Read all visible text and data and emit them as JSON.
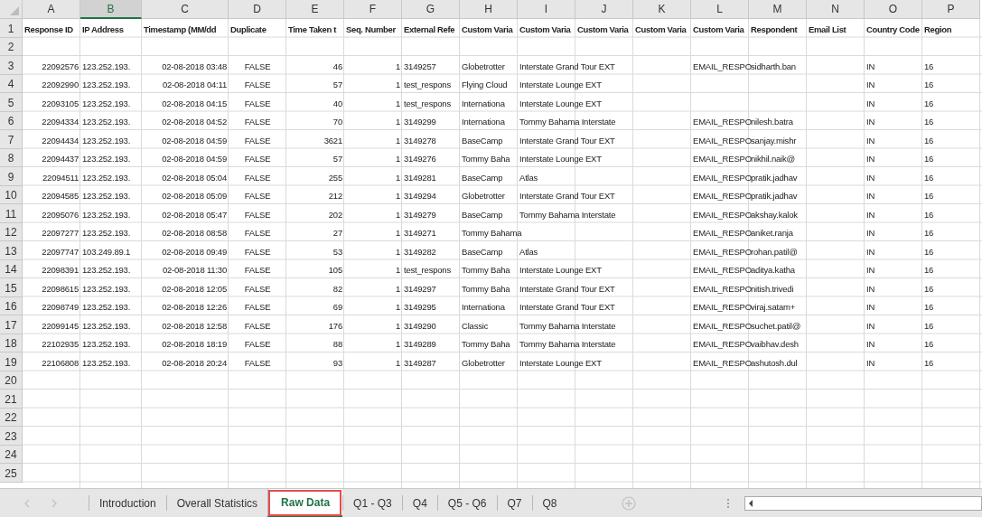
{
  "columns": [
    {
      "letter": "A",
      "kind": "number",
      "selected": false
    },
    {
      "letter": "B",
      "kind": "text",
      "selected": true
    },
    {
      "letter": "C",
      "kind": "date",
      "selected": false
    },
    {
      "letter": "D",
      "kind": "boolean",
      "selected": false
    },
    {
      "letter": "E",
      "kind": "number",
      "selected": false
    },
    {
      "letter": "F",
      "kind": "number",
      "selected": false
    },
    {
      "letter": "G",
      "kind": "text",
      "selected": false
    },
    {
      "letter": "H",
      "kind": "text",
      "selected": false
    },
    {
      "letter": "I",
      "kind": "text",
      "selected": false
    },
    {
      "letter": "J",
      "kind": "text",
      "selected": false
    },
    {
      "letter": "K",
      "kind": "text",
      "selected": false
    },
    {
      "letter": "L",
      "kind": "text",
      "selected": false
    },
    {
      "letter": "M",
      "kind": "text",
      "selected": false
    },
    {
      "letter": "N",
      "kind": "text",
      "selected": false
    },
    {
      "letter": "O",
      "kind": "text",
      "selected": false
    },
    {
      "letter": "P",
      "kind": "text",
      "selected": false
    }
  ],
  "rows": [
    {
      "num": "1",
      "kind": "header",
      "cells": {
        "A": "Response ID",
        "B": "IP Address",
        "C": "Timestamp (MM/dd",
        "D": "Duplicate",
        "E": "Time Taken t",
        "F": "Seq. Number",
        "G": "External Refe",
        "H": "Custom Varia",
        "I": "Custom Varia",
        "J": "Custom Varia",
        "K": "Custom Varia",
        "L": "Custom Varia",
        "M": "Respondent",
        "N": "Email List",
        "O": "Country Code",
        "P": "Region"
      }
    },
    {
      "num": "2",
      "kind": "data"
    },
    {
      "num": "3",
      "kind": "data",
      "cells": {
        "A": "22092576",
        "B": "123.252.193.",
        "C": "02-08-2018 03:48",
        "D": "FALSE",
        "E": "46",
        "F": "1",
        "G": "3149257",
        "H": "Globetrotter",
        "I": "Interstate Grand Tour EXT",
        "L": "EMAIL_RESPO",
        "M": "sidharth.ban",
        "O": "IN",
        "P": "16"
      }
    },
    {
      "num": "4",
      "kind": "data",
      "cells": {
        "A": "22092990",
        "B": "123.252.193.",
        "C": "02-08-2018 04:11",
        "D": "FALSE",
        "E": "57",
        "F": "1",
        "G": "test_respons",
        "H": "Flying Cloud",
        "I": "Interstate Lounge EXT",
        "O": "IN",
        "P": "16"
      }
    },
    {
      "num": "5",
      "kind": "data",
      "cells": {
        "A": "22093105",
        "B": "123.252.193.",
        "C": "02-08-2018 04:15",
        "D": "FALSE",
        "E": "40",
        "F": "1",
        "G": "test_respons",
        "H": "Internationa",
        "I": "Interstate Lounge EXT",
        "O": "IN",
        "P": "16"
      }
    },
    {
      "num": "6",
      "kind": "data",
      "cells": {
        "A": "22094334",
        "B": "123.252.193.",
        "C": "02-08-2018 04:52",
        "D": "FALSE",
        "E": "70",
        "F": "1",
        "G": "3149299",
        "H": "Internationa",
        "I": "Tommy Bahama Interstate",
        "L": "EMAIL_RESPO",
        "M": "nilesh.batra",
        "O": "IN",
        "P": "16"
      }
    },
    {
      "num": "7",
      "kind": "data",
      "cells": {
        "A": "22094434",
        "B": "123.252.193.",
        "C": "02-08-2018 04:59",
        "D": "FALSE",
        "E": "3621",
        "F": "1",
        "G": "3149278",
        "H": "BaseCamp",
        "I": "Interstate Grand Tour EXT",
        "L": "EMAIL_RESPO",
        "M": "sanjay.mishr",
        "O": "IN",
        "P": "16"
      }
    },
    {
      "num": "8",
      "kind": "data",
      "cells": {
        "A": "22094437",
        "B": "123.252.193.",
        "C": "02-08-2018 04:59",
        "D": "FALSE",
        "E": "57",
        "F": "1",
        "G": "3149276",
        "H": "Tommy Baha",
        "I": "Interstate Lounge EXT",
        "L": "EMAIL_RESPO",
        "M": "nikhil.naik@",
        "O": "IN",
        "P": "16"
      }
    },
    {
      "num": "9",
      "kind": "data",
      "cells": {
        "A": "22094511",
        "B": "123.252.193.",
        "C": "02-08-2018 05:04",
        "D": "FALSE",
        "E": "255",
        "F": "1",
        "G": "3149281",
        "H": "BaseCamp",
        "I": "Atlas",
        "L": "EMAIL_RESPO",
        "M": "pratik.jadhav",
        "O": "IN",
        "P": "16"
      }
    },
    {
      "num": "10",
      "kind": "data",
      "cells": {
        "A": "22094585",
        "B": "123.252.193.",
        "C": "02-08-2018 05:09",
        "D": "FALSE",
        "E": "212",
        "F": "1",
        "G": "3149294",
        "H": "Globetrotter",
        "I": "Interstate Grand Tour EXT",
        "L": "EMAIL_RESPO",
        "M": "pratik.jadhav",
        "O": "IN",
        "P": "16"
      }
    },
    {
      "num": "11",
      "kind": "data",
      "cells": {
        "A": "22095076",
        "B": "123.252.193.",
        "C": "02-08-2018 05:47",
        "D": "FALSE",
        "E": "202",
        "F": "1",
        "G": "3149279",
        "H": "BaseCamp",
        "I": "Tommy Bahama Interstate",
        "L": "EMAIL_RESPO",
        "M": "akshay.kalok",
        "O": "IN",
        "P": "16"
      }
    },
    {
      "num": "12",
      "kind": "data",
      "cells": {
        "A": "22097277",
        "B": "123.252.193.",
        "C": "02-08-2018 08:58",
        "D": "FALSE",
        "E": "27",
        "F": "1",
        "G": "3149271",
        "H": "Tommy Bahama",
        "L": "EMAIL_RESPO",
        "M": "aniket.ranja",
        "O": "IN",
        "P": "16"
      }
    },
    {
      "num": "13",
      "kind": "data",
      "cells": {
        "A": "22097747",
        "B": "103.249.89.1",
        "C": "02-08-2018 09:49",
        "D": "FALSE",
        "E": "53",
        "F": "1",
        "G": "3149282",
        "H": "BaseCamp",
        "I": "Atlas",
        "L": "EMAIL_RESPO",
        "M": "rohan.patil@",
        "O": "IN",
        "P": "16"
      }
    },
    {
      "num": "14",
      "kind": "data",
      "cells": {
        "A": "22098391",
        "B": "123.252.193.",
        "C": "02-08-2018 11:30",
        "D": "FALSE",
        "E": "105",
        "F": "1",
        "G": "test_respons",
        "H": "Tommy Baha",
        "I": "Interstate Lounge EXT",
        "L": "EMAIL_RESPO",
        "M": "aditya.katha",
        "O": "IN",
        "P": "16"
      }
    },
    {
      "num": "15",
      "kind": "data",
      "cells": {
        "A": "22098615",
        "B": "123.252.193.",
        "C": "02-08-2018 12:05",
        "D": "FALSE",
        "E": "82",
        "F": "1",
        "G": "3149297",
        "H": "Tommy Baha",
        "I": "Interstate Grand Tour EXT",
        "L": "EMAIL_RESPO",
        "M": "nitish.trivedi",
        "O": "IN",
        "P": "16"
      }
    },
    {
      "num": "16",
      "kind": "data",
      "cells": {
        "A": "22098749",
        "B": "123.252.193.",
        "C": "02-08-2018 12:26",
        "D": "FALSE",
        "E": "69",
        "F": "1",
        "G": "3149295",
        "H": "Internationa",
        "I": "Interstate Grand Tour EXT",
        "L": "EMAIL_RESPO",
        "M": "viraj.satam+",
        "O": "IN",
        "P": "16"
      }
    },
    {
      "num": "17",
      "kind": "data",
      "cells": {
        "A": "22099145",
        "B": "123.252.193.",
        "C": "02-08-2018 12:58",
        "D": "FALSE",
        "E": "176",
        "F": "1",
        "G": "3149290",
        "H": "Classic",
        "I": "Tommy Bahama Interstate",
        "L": "EMAIL_RESPO",
        "M": "suchet.patil@",
        "O": "IN",
        "P": "16"
      }
    },
    {
      "num": "18",
      "kind": "data",
      "cells": {
        "A": "22102935",
        "B": "123.252.193.",
        "C": "02-08-2018 18:19",
        "D": "FALSE",
        "E": "88",
        "F": "1",
        "G": "3149289",
        "H": "Tommy Baha",
        "I": "Tommy Bahama Interstate",
        "L": "EMAIL_RESPO",
        "M": "vaibhav.desh",
        "O": "IN",
        "P": "16"
      }
    },
    {
      "num": "19",
      "kind": "data",
      "cells": {
        "A": "22106808",
        "B": "123.252.193.",
        "C": "02-08-2018 20:24",
        "D": "FALSE",
        "E": "93",
        "F": "1",
        "G": "3149287",
        "H": "Globetrotter",
        "I": "Interstate Lounge EXT",
        "L": "EMAIL_RESPO",
        "M": "ashutosh.dul",
        "O": "IN",
        "P": "16"
      }
    },
    {
      "num": "20",
      "kind": "data"
    },
    {
      "num": "21",
      "kind": "data"
    },
    {
      "num": "22",
      "kind": "data"
    },
    {
      "num": "23",
      "kind": "data"
    },
    {
      "num": "24",
      "kind": "data"
    },
    {
      "num": "25",
      "kind": "data"
    }
  ],
  "sheet_tabs": [
    {
      "label": "Introduction",
      "selected": false,
      "highlighted": false
    },
    {
      "label": "Overall Statistics",
      "selected": false,
      "highlighted": false
    },
    {
      "label": "Raw Data",
      "selected": true,
      "highlighted": true
    },
    {
      "label": "Q1 - Q3",
      "selected": false,
      "highlighted": false
    },
    {
      "label": "Q4",
      "selected": false,
      "highlighted": false
    },
    {
      "label": "Q5 - Q6",
      "selected": false,
      "highlighted": false
    },
    {
      "label": "Q7",
      "selected": false,
      "highlighted": false
    },
    {
      "label": "Q8",
      "selected": false,
      "highlighted": false
    }
  ]
}
